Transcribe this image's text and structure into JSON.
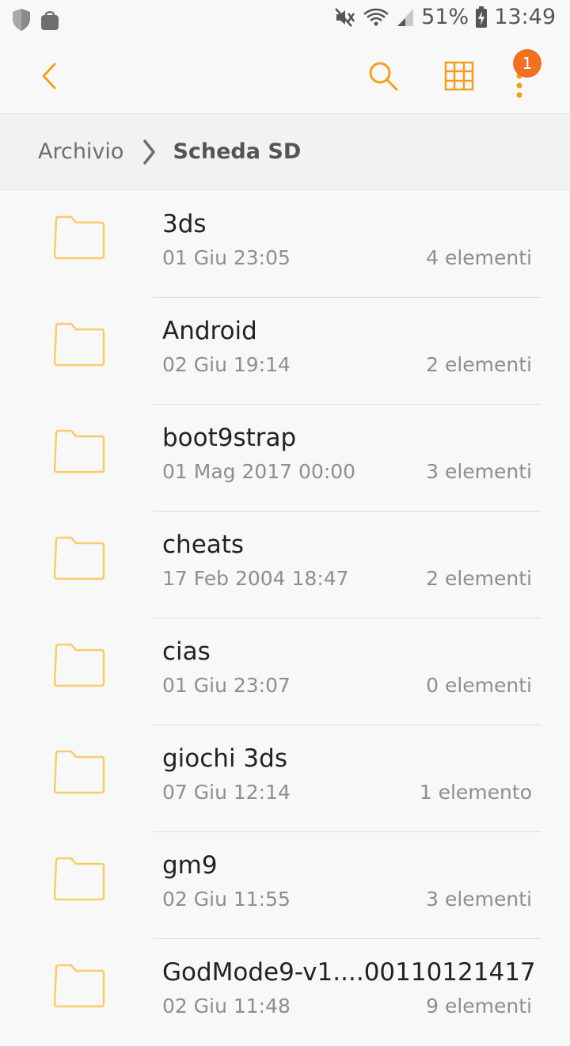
{
  "status_bar": {
    "battery_percent": "51%",
    "time": "13:49",
    "left_icons": [
      "shield-icon",
      "shopping-bag-icon"
    ],
    "right_icons": [
      "mute-icon",
      "wifi-icon",
      "signal-icon",
      "battery-icon"
    ]
  },
  "toolbar": {
    "back_icon": "chevron-left-icon",
    "search_icon": "search-icon",
    "grid_icon": "grid-view-icon",
    "more_icon": "more-vert-icon",
    "notification_badge": "1",
    "accent_color": "#f5a623"
  },
  "breadcrumb": {
    "root": "Archivio",
    "current": "Scheda SD"
  },
  "files": [
    {
      "name": "3ds",
      "date": "01 Giu 23:05",
      "count": "4 elementi"
    },
    {
      "name": "Android",
      "date": "02 Giu 19:14",
      "count": "2 elementi"
    },
    {
      "name": "boot9strap",
      "date": "01 Mag 2017 00:00",
      "count": "3 elementi"
    },
    {
      "name": "cheats",
      "date": "17 Feb 2004 18:47",
      "count": "2 elementi"
    },
    {
      "name": "cias",
      "date": "01 Giu 23:07",
      "count": "0 elementi"
    },
    {
      "name": "giochi 3ds",
      "date": "07 Giu 12:14",
      "count": "1 elemento"
    },
    {
      "name": "gm9",
      "date": "02 Giu 11:55",
      "count": "3 elementi"
    },
    {
      "name": "GodMode9-v1....00110121417",
      "date": "02 Giu 11:48",
      "count": "9 elementi"
    }
  ]
}
